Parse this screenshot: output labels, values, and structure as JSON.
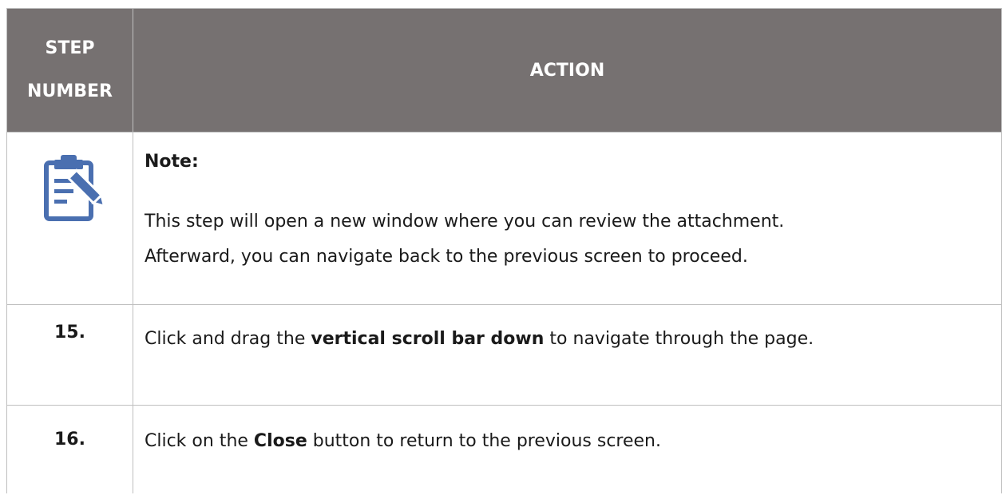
{
  "header": {
    "step_number_line1": "STEP",
    "step_number_line2": "NUMBER",
    "action": "ACTION"
  },
  "note": {
    "icon": "clipboard-edit-icon",
    "icon_color": "#4a6fb0",
    "title": "Note:",
    "line1": "This step will open a new window where you can review the attachment.",
    "line2": "Afterward, you can navigate back to the previous screen to proceed."
  },
  "steps": [
    {
      "number": "15.",
      "text_before": "Click and drag the ",
      "text_bold": "vertical scroll bar down",
      "text_after": " to navigate through the page."
    },
    {
      "number": "16.",
      "text_before": "Click on the ",
      "text_bold": "Close",
      "text_after": " button to return to the previous screen."
    }
  ],
  "colors": {
    "header_bg": "#767171",
    "header_text": "#ffffff",
    "border": "#bfbfbf"
  }
}
